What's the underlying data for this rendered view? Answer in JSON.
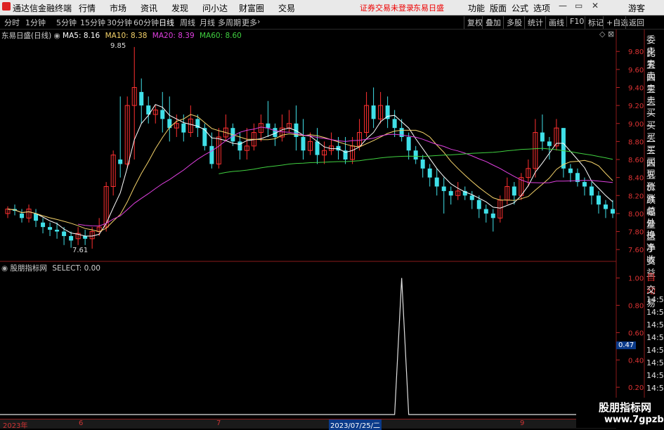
{
  "app": {
    "title": "通达信金融终端"
  },
  "menu": [
    "行情",
    "市场",
    "资讯",
    "发现",
    "问小达",
    "财富圈",
    "交易"
  ],
  "status": {
    "login": "证券交易未登录",
    "stock": "东易日盛"
  },
  "right_menu": [
    "功能",
    "版面",
    "公式",
    "选项"
  ],
  "guest": "游客",
  "periods": [
    "分时",
    "1分钟",
    "5分钟",
    "15分钟",
    "30分钟",
    "60分钟",
    "日线",
    "周线",
    "月线",
    "多周期",
    "更多"
  ],
  "active_period": "日线",
  "tools": [
    "复权",
    "叠加",
    "多股",
    "统计",
    "画线",
    "F10",
    "标记",
    "+自选",
    "返回"
  ],
  "ma": {
    "title": "东易日盛(日线)",
    "ma5": "MA5: 8.16",
    "ma10": "MA10: 8.38",
    "ma20": "MA20: 8.39",
    "ma60": "MA60: 8.60",
    "colors": {
      "ma5": "#ffffff",
      "ma10": "#f5d36a",
      "ma20": "#e040e0",
      "ma60": "#40d040"
    }
  },
  "indicator": {
    "name": "股朋指标网",
    "select": "SELECT: 0.00"
  },
  "price_axis": [
    "9.80",
    "9.60",
    "9.40",
    "9.20",
    "9.00",
    "8.80",
    "8.60",
    "8.40",
    "8.20",
    "8.00",
    "7.80",
    "7.60"
  ],
  "ind_axis": [
    "1.00",
    "0.80",
    "0.60",
    "0.40",
    "0.20"
  ],
  "ind_marker": "0.47",
  "annotations": {
    "high": "9.85",
    "low": "7.61"
  },
  "right_panel": {
    "top": [
      "委比",
      "卖五",
      "卖四",
      "卖三",
      "卖二",
      "卖一",
      "买一",
      "买二",
      "买三",
      "买四",
      "买五",
      "现价",
      "涨跌",
      "涨幅",
      "总量",
      "外盘",
      "换手",
      "净资",
      "收益"
    ],
    "bottom": [
      "自动",
      "交易",
      "14:56",
      "14:56",
      "14:56",
      "14:56",
      "14:56",
      "14:56",
      "14:56",
      "14:56",
      "14:56"
    ]
  },
  "time_axis": {
    "ticks": [
      "2023年",
      "6",
      "7",
      "9"
    ],
    "highlight": "2023/07/25/二"
  },
  "watermark": {
    "line1": "股朋指标网",
    "line2": "www.7gpzb.com"
  },
  "chart_data": {
    "type": "candlestick",
    "ylim": [
      7.5,
      9.95
    ],
    "candles": [
      [
        8.0,
        8.05,
        7.95,
        8.08
      ],
      [
        8.05,
        8.03,
        7.98,
        8.1
      ],
      [
        8.0,
        7.95,
        7.9,
        8.05
      ],
      [
        7.95,
        8.05,
        7.9,
        8.1
      ],
      [
        8.0,
        7.92,
        7.85,
        8.05
      ],
      [
        7.9,
        7.85,
        7.78,
        7.95
      ],
      [
        7.85,
        7.82,
        7.75,
        7.9
      ],
      [
        7.82,
        7.8,
        7.72,
        7.9
      ],
      [
        7.8,
        7.75,
        7.65,
        7.85
      ],
      [
        7.75,
        7.7,
        7.62,
        7.8
      ],
      [
        7.72,
        7.78,
        7.65,
        7.85
      ],
      [
        7.75,
        7.72,
        7.65,
        7.82
      ],
      [
        7.72,
        7.8,
        7.61,
        7.85
      ],
      [
        7.8,
        7.85,
        7.75,
        7.95
      ],
      [
        7.85,
        8.3,
        7.8,
        8.35
      ],
      [
        8.3,
        8.65,
        8.2,
        8.7
      ],
      [
        8.6,
        8.55,
        8.4,
        9.3
      ],
      [
        8.55,
        9.2,
        8.5,
        9.3
      ],
      [
        9.2,
        9.4,
        8.6,
        9.85
      ],
      [
        9.35,
        9.2,
        9.0,
        9.5
      ],
      [
        9.2,
        9.1,
        9.0,
        9.3
      ],
      [
        9.1,
        9.15,
        9.0,
        9.2
      ],
      [
        9.15,
        9.05,
        8.9,
        9.35
      ],
      [
        9.05,
        8.95,
        8.8,
        9.3
      ],
      [
        8.95,
        9.0,
        8.85,
        9.1
      ],
      [
        9.0,
        8.9,
        8.8,
        9.1
      ],
      [
        8.9,
        9.05,
        8.85,
        9.2
      ],
      [
        9.05,
        8.95,
        8.85,
        9.1
      ],
      [
        8.95,
        8.75,
        8.7,
        9.0
      ],
      [
        8.75,
        8.55,
        8.5,
        8.9
      ],
      [
        8.55,
        8.85,
        8.5,
        8.95
      ],
      [
        8.85,
        8.95,
        8.8,
        9.1
      ],
      [
        8.95,
        8.8,
        8.75,
        9.0
      ],
      [
        8.8,
        8.7,
        8.6,
        8.9
      ],
      [
        8.7,
        8.75,
        8.6,
        8.95
      ],
      [
        8.75,
        8.9,
        8.7,
        9.0
      ],
      [
        8.9,
        9.0,
        8.8,
        9.1
      ],
      [
        9.0,
        8.95,
        8.85,
        9.25
      ],
      [
        8.95,
        8.85,
        8.75,
        9.0
      ],
      [
        8.85,
        8.95,
        8.8,
        9.1
      ],
      [
        8.95,
        9.0,
        8.9,
        9.15
      ],
      [
        9.0,
        8.85,
        8.7,
        9.2
      ],
      [
        8.85,
        8.7,
        8.6,
        9.05
      ],
      [
        8.7,
        8.8,
        8.65,
        8.9
      ],
      [
        8.8,
        8.65,
        8.55,
        8.95
      ],
      [
        8.65,
        8.7,
        8.55,
        8.8
      ],
      [
        8.7,
        8.75,
        8.65,
        8.9
      ],
      [
        8.75,
        8.7,
        8.6,
        8.85
      ],
      [
        8.7,
        8.6,
        8.55,
        8.85
      ],
      [
        8.6,
        8.75,
        8.55,
        8.85
      ],
      [
        8.75,
        8.9,
        8.7,
        9.05
      ],
      [
        8.9,
        9.2,
        8.85,
        9.35
      ],
      [
        9.2,
        9.05,
        8.95,
        9.4
      ],
      [
        9.05,
        9.2,
        9.0,
        9.35
      ],
      [
        9.2,
        9.05,
        8.95,
        9.3
      ],
      [
        9.05,
        8.95,
        8.85,
        9.15
      ],
      [
        8.95,
        8.85,
        8.8,
        9.05
      ],
      [
        8.85,
        8.7,
        8.6,
        8.9
      ],
      [
        8.7,
        8.6,
        8.55,
        8.75
      ],
      [
        8.6,
        8.5,
        8.4,
        8.65
      ],
      [
        8.5,
        8.4,
        8.3,
        8.55
      ],
      [
        8.4,
        8.3,
        8.2,
        8.5
      ],
      [
        8.3,
        8.25,
        8.0,
        8.4
      ],
      [
        8.25,
        8.2,
        8.1,
        8.3
      ],
      [
        8.2,
        8.25,
        8.15,
        8.35
      ],
      [
        8.25,
        8.2,
        8.15,
        8.3
      ],
      [
        8.2,
        8.15,
        8.05,
        8.25
      ],
      [
        8.15,
        8.05,
        7.95,
        8.2
      ],
      [
        8.05,
        8.0,
        7.9,
        8.1
      ],
      [
        8.0,
        7.95,
        7.8,
        8.05
      ],
      [
        7.95,
        8.15,
        7.9,
        8.2
      ],
      [
        8.15,
        8.3,
        8.1,
        8.4
      ],
      [
        8.3,
        8.2,
        8.1,
        8.35
      ],
      [
        8.2,
        8.4,
        8.15,
        8.45
      ],
      [
        8.4,
        8.5,
        8.3,
        8.6
      ],
      [
        8.5,
        8.9,
        8.4,
        9.05
      ],
      [
        8.9,
        8.8,
        8.7,
        9.1
      ],
      [
        8.8,
        8.75,
        8.6,
        8.85
      ],
      [
        8.75,
        8.95,
        8.7,
        9.05
      ],
      [
        8.95,
        8.5,
        8.4,
        8.95
      ],
      [
        8.5,
        8.45,
        8.35,
        8.55
      ],
      [
        8.45,
        8.35,
        8.3,
        8.5
      ],
      [
        8.35,
        8.3,
        8.2,
        8.4
      ],
      [
        8.3,
        8.2,
        8.1,
        8.35
      ],
      [
        8.2,
        8.1,
        8.0,
        8.25
      ],
      [
        8.1,
        8.05,
        7.95,
        8.15
      ],
      [
        8.05,
        8.0,
        7.95,
        8.15
      ]
    ],
    "select_spike_index": 56
  }
}
